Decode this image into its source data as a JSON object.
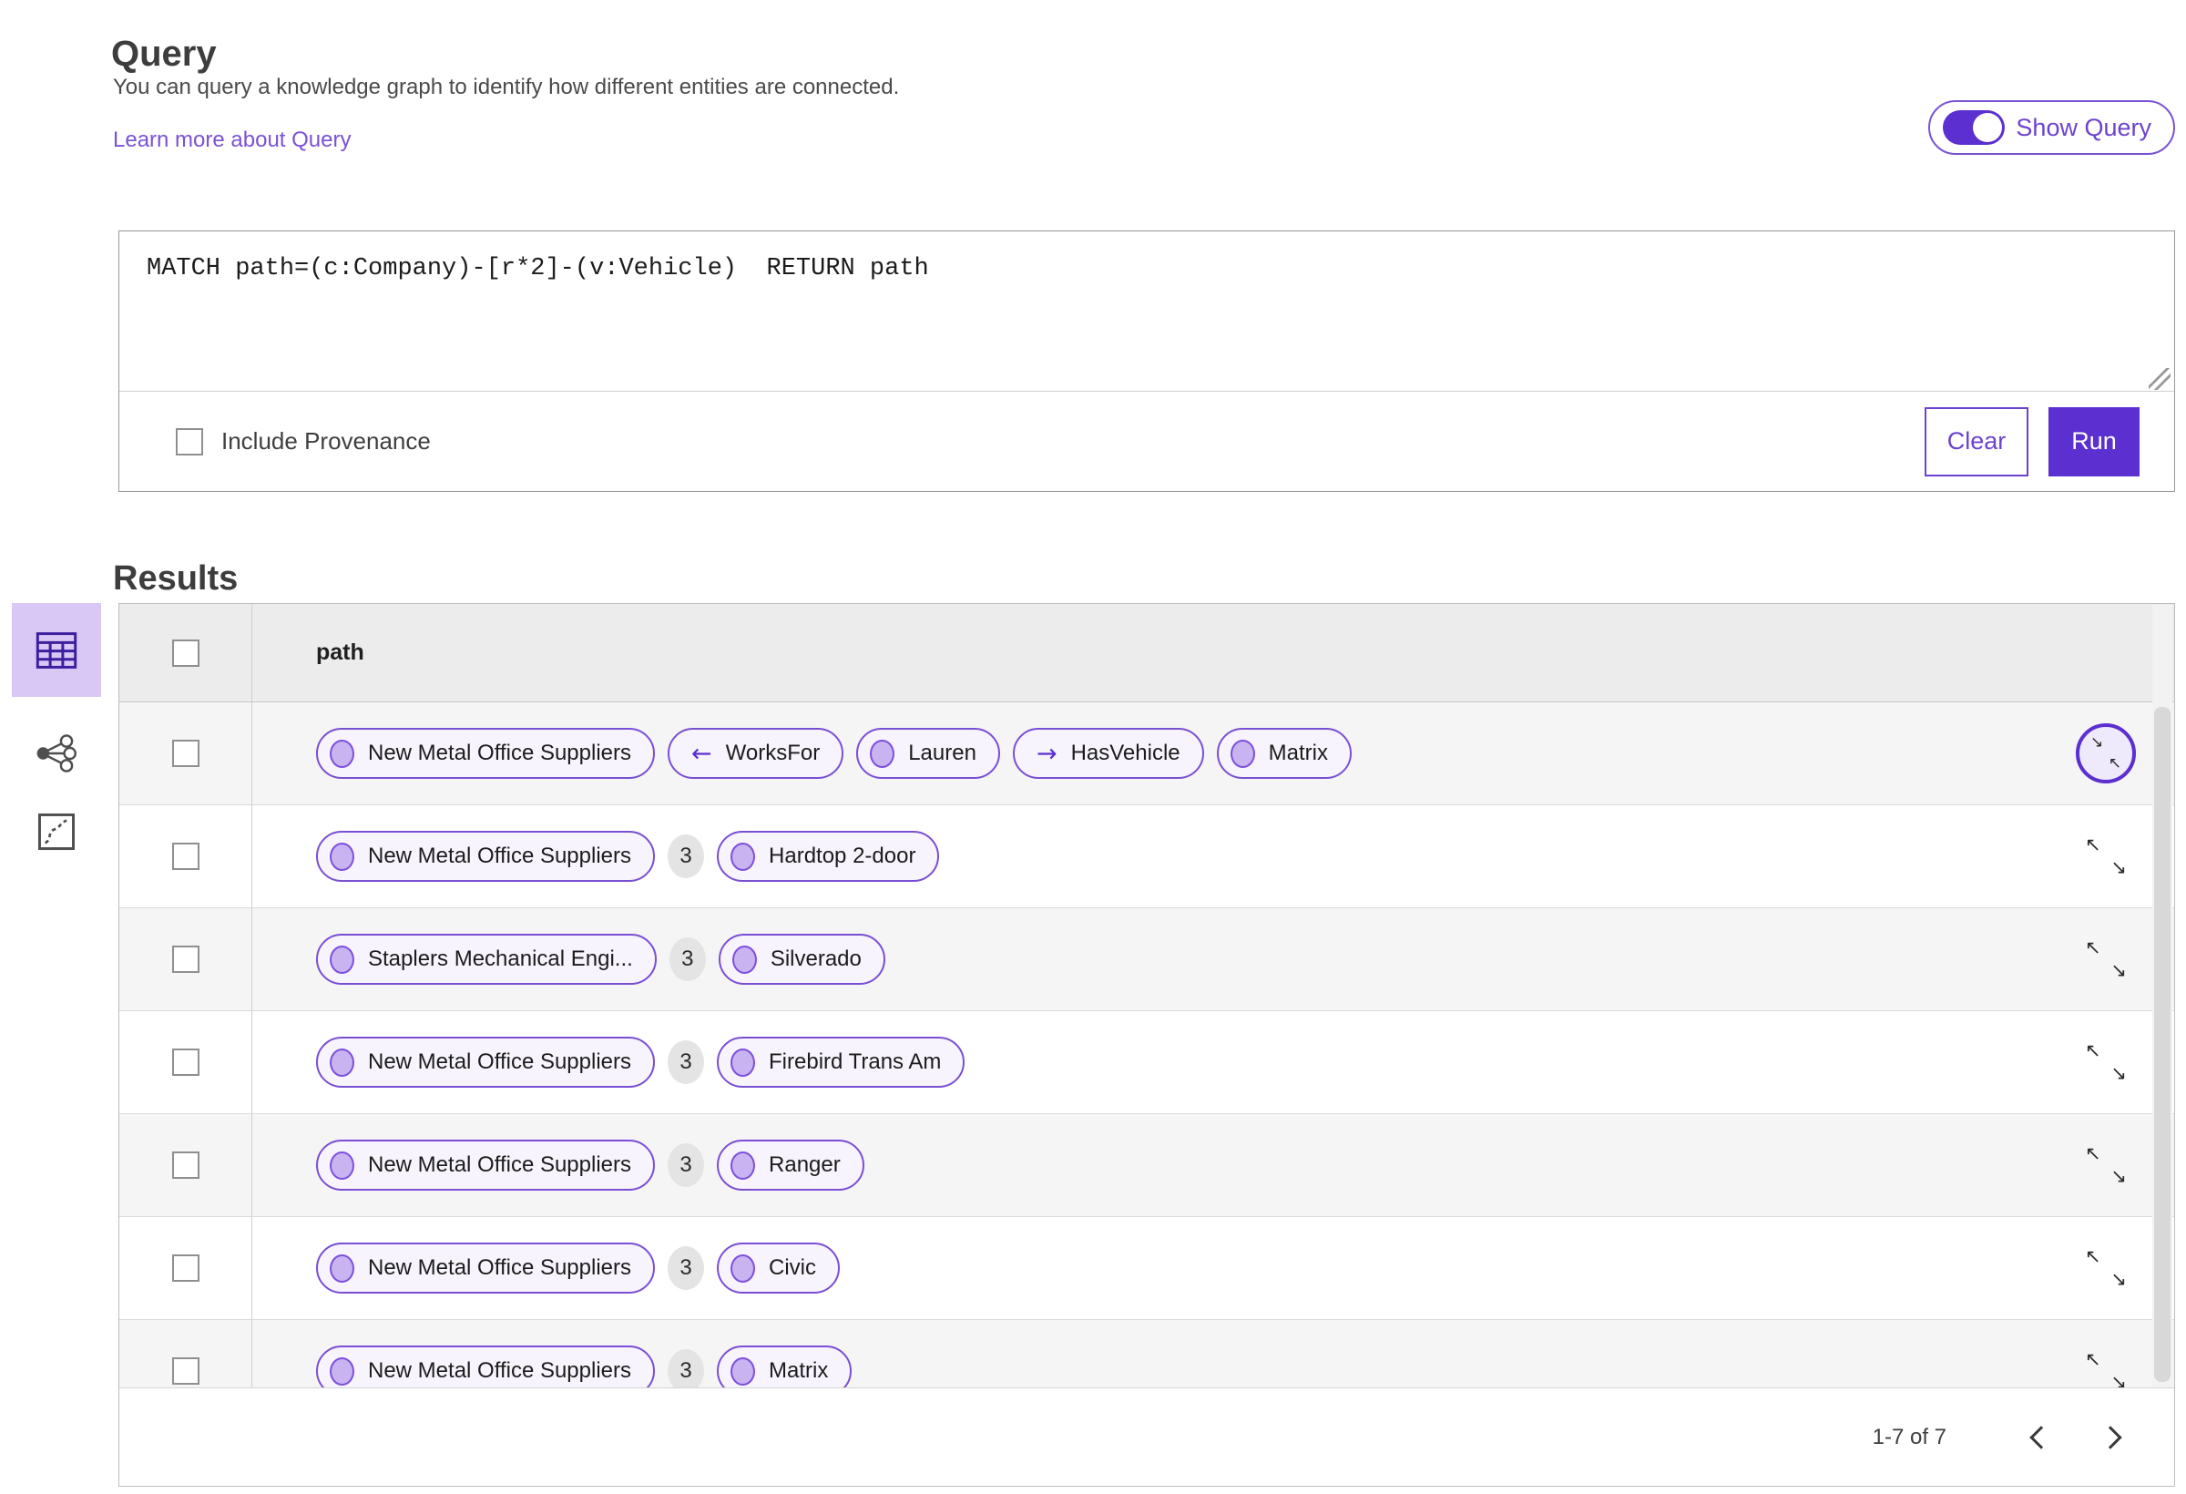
{
  "query_section": {
    "title": "Query",
    "description": "You can query a knowledge graph to identify how different entities are connected.",
    "learn_more_link": "Learn more about Query",
    "show_query_toggle": {
      "label": "Show Query",
      "state": "on"
    },
    "query_input": {
      "value": "MATCH path=(c:Company)-[r*2]-(v:Vehicle)  RETURN path"
    },
    "include_provenance": {
      "label": "Include Provenance",
      "checked": false
    },
    "buttons": {
      "clear": "Clear",
      "run": "Run"
    }
  },
  "results_section": {
    "title": "Results",
    "view_switcher": {
      "items": [
        {
          "name": "table-view",
          "selected": true
        },
        {
          "name": "graph-view",
          "selected": false
        },
        {
          "name": "map-view",
          "selected": false
        }
      ]
    },
    "table": {
      "column_header": "path",
      "select_all_checked": false,
      "rows": [
        {
          "row_icon": "collapse-circled",
          "cells": [
            {
              "t": "node",
              "label": "New Metal Office Suppliers"
            },
            {
              "t": "edge",
              "dir": "left",
              "label": "WorksFor"
            },
            {
              "t": "node",
              "label": "Lauren"
            },
            {
              "t": "edge",
              "dir": "right",
              "label": "HasVehicle"
            },
            {
              "t": "node",
              "label": "Matrix"
            }
          ]
        },
        {
          "row_icon": "expand",
          "cells": [
            {
              "t": "node",
              "label": "New Metal Office Suppliers"
            },
            {
              "t": "count",
              "label": "3"
            },
            {
              "t": "node",
              "label": "Hardtop 2-door"
            }
          ]
        },
        {
          "row_icon": "expand",
          "cells": [
            {
              "t": "node",
              "label": "Staplers Mechanical Engi..."
            },
            {
              "t": "count",
              "label": "3"
            },
            {
              "t": "node",
              "label": "Silverado"
            }
          ]
        },
        {
          "row_icon": "expand",
          "cells": [
            {
              "t": "node",
              "label": "New Metal Office Suppliers"
            },
            {
              "t": "count",
              "label": "3"
            },
            {
              "t": "node",
              "label": "Firebird Trans Am"
            }
          ]
        },
        {
          "row_icon": "expand",
          "cells": [
            {
              "t": "node",
              "label": "New Metal Office Suppliers"
            },
            {
              "t": "count",
              "label": "3"
            },
            {
              "t": "node",
              "label": "Ranger"
            }
          ]
        },
        {
          "row_icon": "expand",
          "cells": [
            {
              "t": "node",
              "label": "New Metal Office Suppliers"
            },
            {
              "t": "count",
              "label": "3"
            },
            {
              "t": "node",
              "label": "Civic"
            }
          ]
        },
        {
          "row_icon": "expand",
          "cells": [
            {
              "t": "node",
              "label": "New Metal Office Suppliers"
            },
            {
              "t": "count",
              "label": "3"
            },
            {
              "t": "node",
              "label": "Matrix"
            }
          ]
        }
      ],
      "pagination": {
        "label": "1-7 of 7",
        "prev_icon": "chevron-left",
        "next_icon": "chevron-right"
      }
    }
  },
  "colors": {
    "accent": "#5b2fd0",
    "accent_light": "#7a52d6",
    "pill_background": "#f7f4fd",
    "node_circle_fill": "#c9b3f0",
    "selected_view_background": "#d9c8f6",
    "table_header_background": "#ececec",
    "row_alternate_background": "#f5f5f5"
  }
}
